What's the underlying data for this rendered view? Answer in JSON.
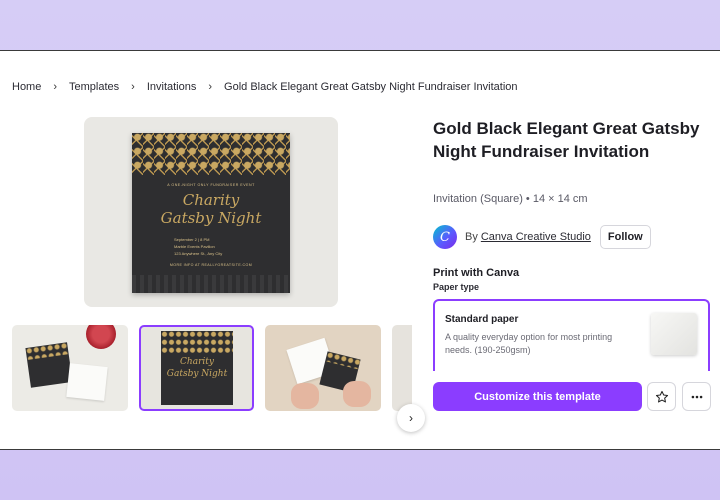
{
  "breadcrumb": {
    "items": [
      "Home",
      "Templates",
      "Invitations",
      "Gold Black Elegant Great Gatsby Night Fundraiser Invitation"
    ]
  },
  "preview": {
    "tagline": "A ONE-NIGHT ONLY FUNDRAISER EVENT",
    "script_line1": "Charity",
    "script_line2": "Gatsby Night",
    "detail1": "September 2 | 8 PM",
    "detail2": "Marble Events Pavilion",
    "detail3": "123 Anywhere St., Any City",
    "footer": "MORE INFO AT REALLYGREATSITE.COM"
  },
  "thumbnails": {
    "t2_line1": "Charity",
    "t2_line2": "Gatsby Night"
  },
  "product": {
    "title": "Gold Black Elegant Great Gatsby Night Fundraiser Invitation",
    "meta": "Invitation (Square) • 14 × 14 cm",
    "by": "By",
    "creator": "Canva Creative Studio",
    "follow_label": "Follow"
  },
  "print": {
    "title": "Print with Canva",
    "paper_type_label": "Paper type",
    "option_name": "Standard paper",
    "option_desc": "A quality everyday option for most printing needs. (190-250gsm)"
  },
  "actions": {
    "cta_label": "Customize this template"
  },
  "colors": {
    "accent": "#8b3dff",
    "background": "#d6cdf6",
    "card": "#2e2e30",
    "gold": "#c9a862"
  },
  "icons": {
    "separator": "chevron-right-icon",
    "next": "chevron-right-icon",
    "favorite": "star-icon",
    "more": "more-horizontal-icon"
  }
}
